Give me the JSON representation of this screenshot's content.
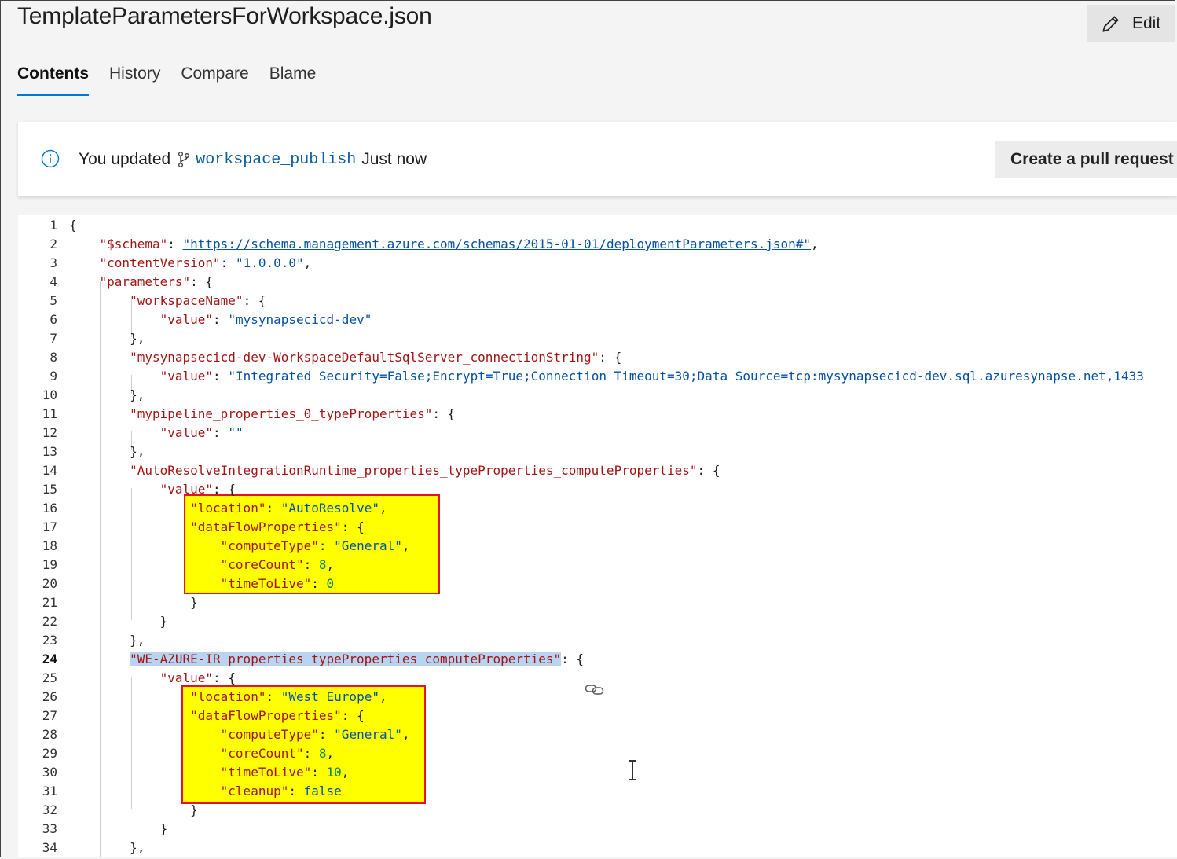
{
  "title": "TemplateParametersForWorkspace.json",
  "edit_label": "Edit",
  "tabs": [
    {
      "label": "Contents",
      "active": true
    },
    {
      "label": "History",
      "active": false
    },
    {
      "label": "Compare",
      "active": false
    },
    {
      "label": "Blame",
      "active": false
    }
  ],
  "banner": {
    "prefix": "You updated",
    "branch": "workspace_publish",
    "suffix": "Just now",
    "pr_button": "Create a pull request"
  },
  "colors": {
    "accent": "#0078d4",
    "highlight_fill": "#ffff00",
    "highlight_border": "#e81123"
  },
  "current_line": 24,
  "code_lines": [
    "{",
    "    \"$schema\": \"https://schema.management.azure.com/schemas/2015-01-01/deploymentParameters.json#\",",
    "    \"contentVersion\": \"1.0.0.0\",",
    "    \"parameters\": {",
    "        \"workspaceName\": {",
    "            \"value\": \"mysynapsecicd-dev\"",
    "        },",
    "        \"mysynapsecicd-dev-WorkspaceDefaultSqlServer_connectionString\": {",
    "            \"value\": \"Integrated Security=False;Encrypt=True;Connection Timeout=30;Data Source=tcp:mysynapsecicd-dev.sql.azuresynapse.net,1433",
    "        },",
    "        \"mypipeline_properties_0_typeProperties\": {",
    "            \"value\": \"\"",
    "        },",
    "        \"AutoResolveIntegrationRuntime_properties_typeProperties_computeProperties\": {",
    "            \"value\": {",
    "                \"location\": \"AutoResolve\",",
    "                \"dataFlowProperties\": {",
    "                    \"computeType\": \"General\",",
    "                    \"coreCount\": 8,",
    "                    \"timeToLive\": 0",
    "                }",
    "            }",
    "        },",
    "        \"WE-AZURE-IR_properties_typeProperties_computeProperties\": {",
    "            \"value\": {",
    "                \"location\": \"West Europe\",",
    "                \"dataFlowProperties\": {",
    "                    \"computeType\": \"General\",",
    "                    \"coreCount\": 8,",
    "                    \"timeToLive\": 10,",
    "                    \"cleanup\": false",
    "                }",
    "            }",
    "        },"
  ]
}
